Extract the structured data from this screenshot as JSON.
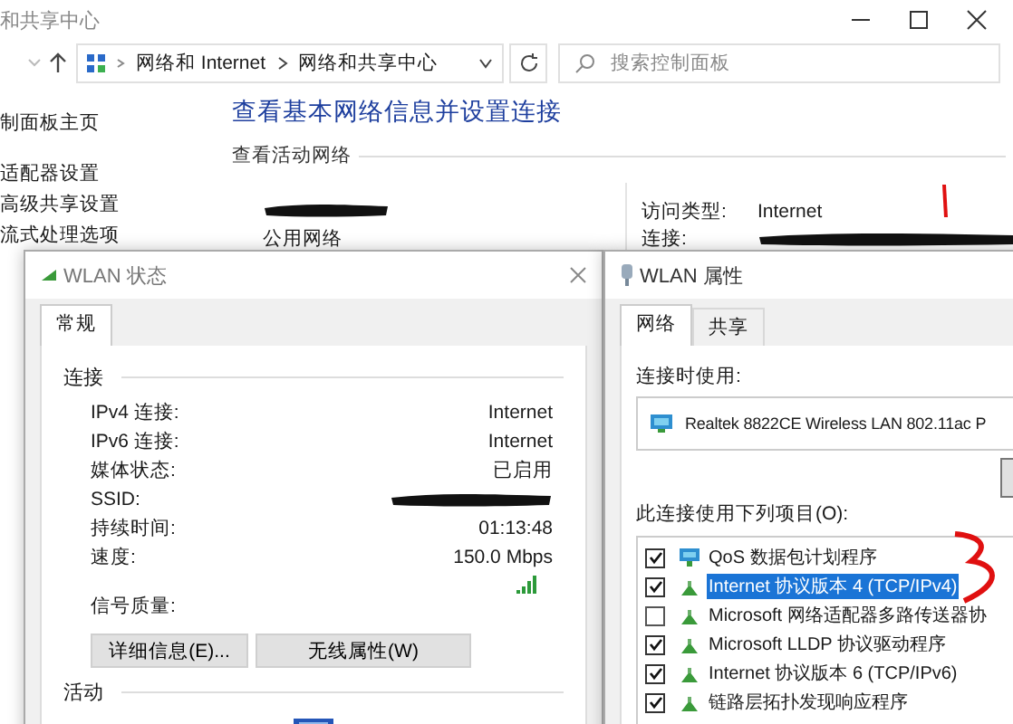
{
  "main_window": {
    "title": "和共享中心",
    "breadcrumb": [
      "网络和 Internet",
      "网络和共享中心"
    ],
    "search": {
      "placeholder": "搜索控制面板"
    },
    "sidebar": {
      "items": [
        "制面板主页",
        "适配器设置",
        "高级共享设置",
        "流式处理选项"
      ]
    },
    "heading": "查看基本网络信息并设置连接",
    "section": "查看活动网络",
    "network_name": {
      "redacted": true
    },
    "network_type": "公用网络",
    "access_type": {
      "label": "访问类型:",
      "value": "Internet"
    },
    "connection": {
      "label": "连接:",
      "redacted": true
    }
  },
  "status_dialog": {
    "title": "WLAN 状态",
    "tabs": [
      {
        "label": "常规",
        "selected": true
      }
    ],
    "group": "连接",
    "rows": [
      {
        "label": "IPv4 连接:",
        "value": "Internet"
      },
      {
        "label": "IPv6 连接:",
        "value": "Internet"
      },
      {
        "label": "媒体状态:",
        "value": "已启用"
      },
      {
        "label": "SSID:",
        "redacted": true
      },
      {
        "label": "持续时间:",
        "value": "01:13:48"
      },
      {
        "label": "速度:",
        "value": "150.0 Mbps"
      }
    ],
    "signal_label": "信号质量:",
    "buttons": [
      "详细信息(E)...",
      "无线属性(W)"
    ],
    "activity": "活动"
  },
  "properties_dialog": {
    "title": "WLAN 属性",
    "tabs": [
      {
        "label": "网络",
        "selected": true
      },
      {
        "label": "共享",
        "selected": false
      }
    ],
    "connect_using_label": "连接时使用:",
    "adapter": "Realtek 8822CE Wireless LAN 802.11ac P",
    "items_label": "此连接使用下列项目(O):",
    "items": [
      {
        "kind": "service",
        "label": "QoS 数据包计划程序",
        "checked": true,
        "selected": false
      },
      {
        "kind": "protocol",
        "label": "Internet 协议版本 4 (TCP/IPv4)",
        "checked": true,
        "selected": true
      },
      {
        "kind": "protocol",
        "label": "Microsoft 网络适配器多路传送器协",
        "checked": false,
        "selected": false
      },
      {
        "kind": "protocol",
        "label": "Microsoft LLDP 协议驱动程序",
        "checked": true,
        "selected": false
      },
      {
        "kind": "protocol",
        "label": "Internet 协议版本 6 (TCP/IPv6)",
        "checked": true,
        "selected": false
      },
      {
        "kind": "protocol",
        "label": "链路层拓扑发现响应程序",
        "checked": true,
        "selected": false
      }
    ]
  }
}
